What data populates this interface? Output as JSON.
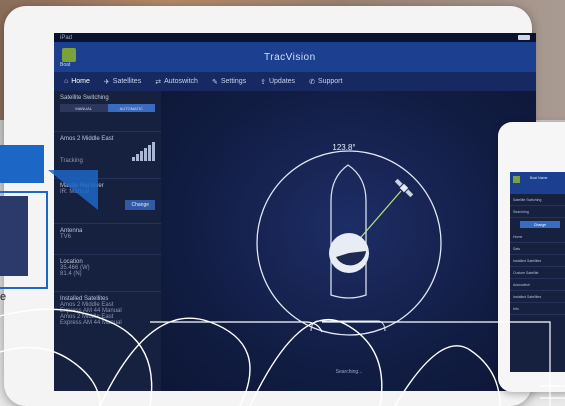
{
  "status": {
    "carrier": "iPad",
    "battery_icon": "battery-icon"
  },
  "header": {
    "logo_caption": "Boat",
    "brand": "TracVision"
  },
  "nav": [
    {
      "label": "Home",
      "icon": "home-icon",
      "glyph": "⌂"
    },
    {
      "label": "Satellites",
      "icon": "satellite-icon",
      "glyph": "✈"
    },
    {
      "label": "Autoswitch",
      "icon": "switch-icon",
      "glyph": "⇄"
    },
    {
      "label": "Settings",
      "icon": "wrench-icon",
      "glyph": "✎"
    },
    {
      "label": "Updates",
      "icon": "updates-icon",
      "glyph": "⇪"
    },
    {
      "label": "Support",
      "icon": "phone-icon",
      "glyph": "✆"
    }
  ],
  "sidebar": {
    "switching_title": "Satellite Switching",
    "seg_options": [
      "MANUAL",
      "AUTOMATIC"
    ],
    "satellite_name": "Amos 2 Middle East",
    "tracking_label": "Tracking",
    "master_title": "Master Receiver",
    "master_value": "IR: Manual",
    "change_button": "Change",
    "antenna_title": "Antenna",
    "antenna_value": "TV6",
    "location_title": "Location",
    "location_lat": "35.466 (W)",
    "location_lon": "81.4 (N)",
    "installed_title": "Installed Satellites",
    "installed": [
      "Amos 2 Middle East",
      "Express AM 44 Manual",
      "Amos 2 Middle East",
      "Express AM 44 Manual"
    ]
  },
  "main": {
    "heading_readout": "123.8°",
    "status_text": "Searching..."
  },
  "phone": {
    "title": "Boat Name",
    "rows": [
      "Satellite Switching",
      "Searching",
      "Home",
      "Sats",
      "Installed Satellites",
      "Custom Satellite",
      "Autoswitch",
      "Installed Satellites",
      "Info"
    ],
    "button": "Change"
  },
  "overlay": {
    "text": "e"
  },
  "colors": {
    "header_blue": "#1c3f8f",
    "accent_blue": "#3b6bbf",
    "logo_green": "#7aa23b",
    "overlay_blue": "#1c66c6"
  }
}
